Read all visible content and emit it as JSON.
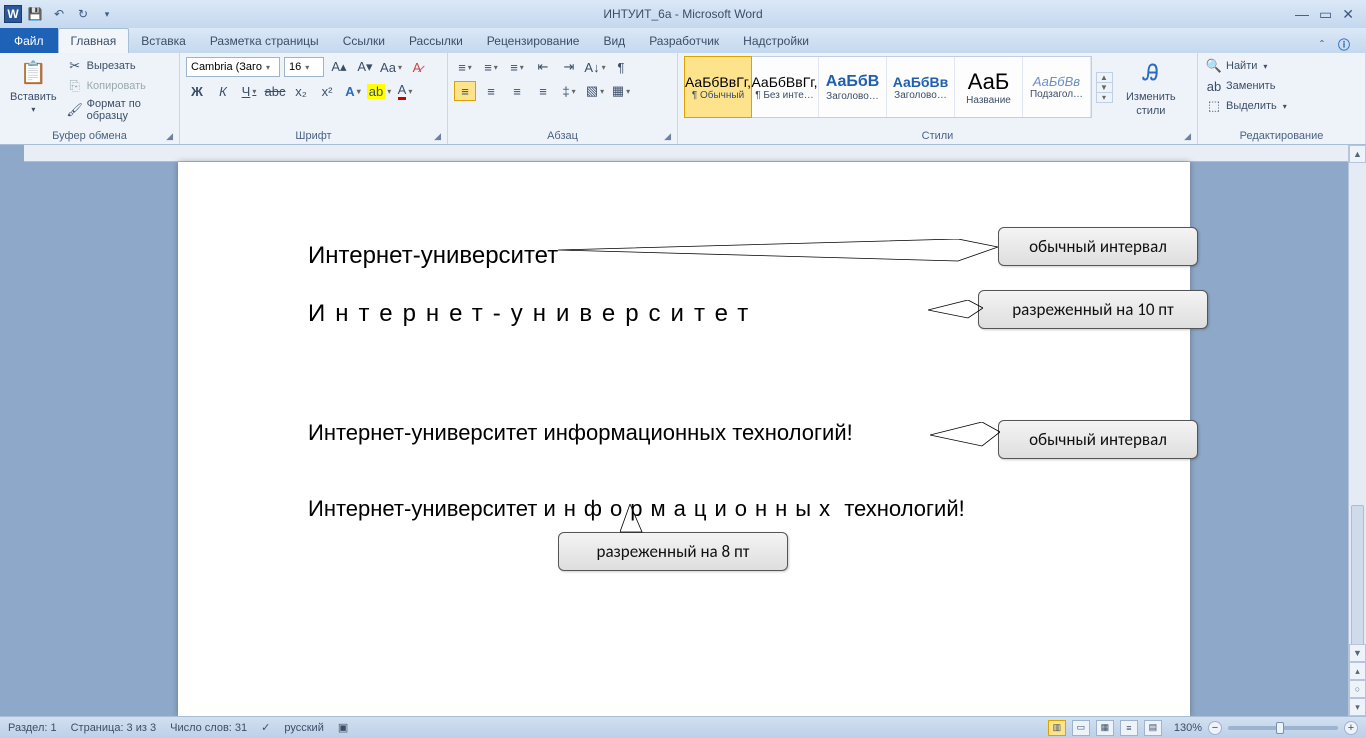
{
  "app": {
    "title": "ИНТУИТ_6а  -  Microsoft Word"
  },
  "tabs": {
    "file": "Файл",
    "items": [
      "Главная",
      "Вставка",
      "Разметка страницы",
      "Ссылки",
      "Рассылки",
      "Рецензирование",
      "Вид",
      "Разработчик",
      "Надстройки"
    ],
    "active": 0
  },
  "clipboard": {
    "paste": "Вставить",
    "cut": "Вырезать",
    "copy": "Копировать",
    "formatpainter": "Формат по образцу",
    "group": "Буфер обмена"
  },
  "font": {
    "name": "Cambria (Заго",
    "size": "16",
    "group": "Шрифт"
  },
  "paragraph": {
    "group": "Абзац"
  },
  "styles": {
    "items": [
      {
        "sample": "АаБбВвГг,",
        "label": "¶ Обычный",
        "sel": true,
        "color": "#000"
      },
      {
        "sample": "АаБбВвГг,",
        "label": "¶ Без инте…",
        "sel": false,
        "color": "#000"
      },
      {
        "sample": "АаБбВ",
        "label": "Заголово…",
        "sel": false,
        "color": "#1f5fae",
        "size": "16px",
        "weight": "bold"
      },
      {
        "sample": "АаБбВв",
        "label": "Заголово…",
        "sel": false,
        "color": "#1f5fae",
        "size": "14px",
        "weight": "bold"
      },
      {
        "sample": "АаБ",
        "label": "Название",
        "sel": false,
        "color": "#000",
        "size": "22px"
      },
      {
        "sample": "АаБбВв",
        "label": "Подзагол…",
        "sel": false,
        "color": "#6b8fc2",
        "size": "13px",
        "style": "italic"
      }
    ],
    "change": "Изменить",
    "change2": "стили",
    "group": "Стили"
  },
  "editing": {
    "find": "Найти",
    "replace": "Заменить",
    "select": "Выделить",
    "group": "Редактирование"
  },
  "document": {
    "line1": "Интернет-университет",
    "line2": "Интернет-университет",
    "line3": "Интернет-университет информационных технологий!",
    "line4a": "Интернет-университет ",
    "line4b": "информационных",
    "line4c": "  технологий!"
  },
  "callouts": {
    "c1": "обычный интервал",
    "c2": "разреженный на 10 пт",
    "c3": "обычный интервал",
    "c4": "разреженный на 8 пт"
  },
  "status": {
    "section": "Раздел: 1",
    "page": "Страница: 3 из 3",
    "words": "Число слов: 31",
    "lang": "русский",
    "zoom": "130%"
  }
}
